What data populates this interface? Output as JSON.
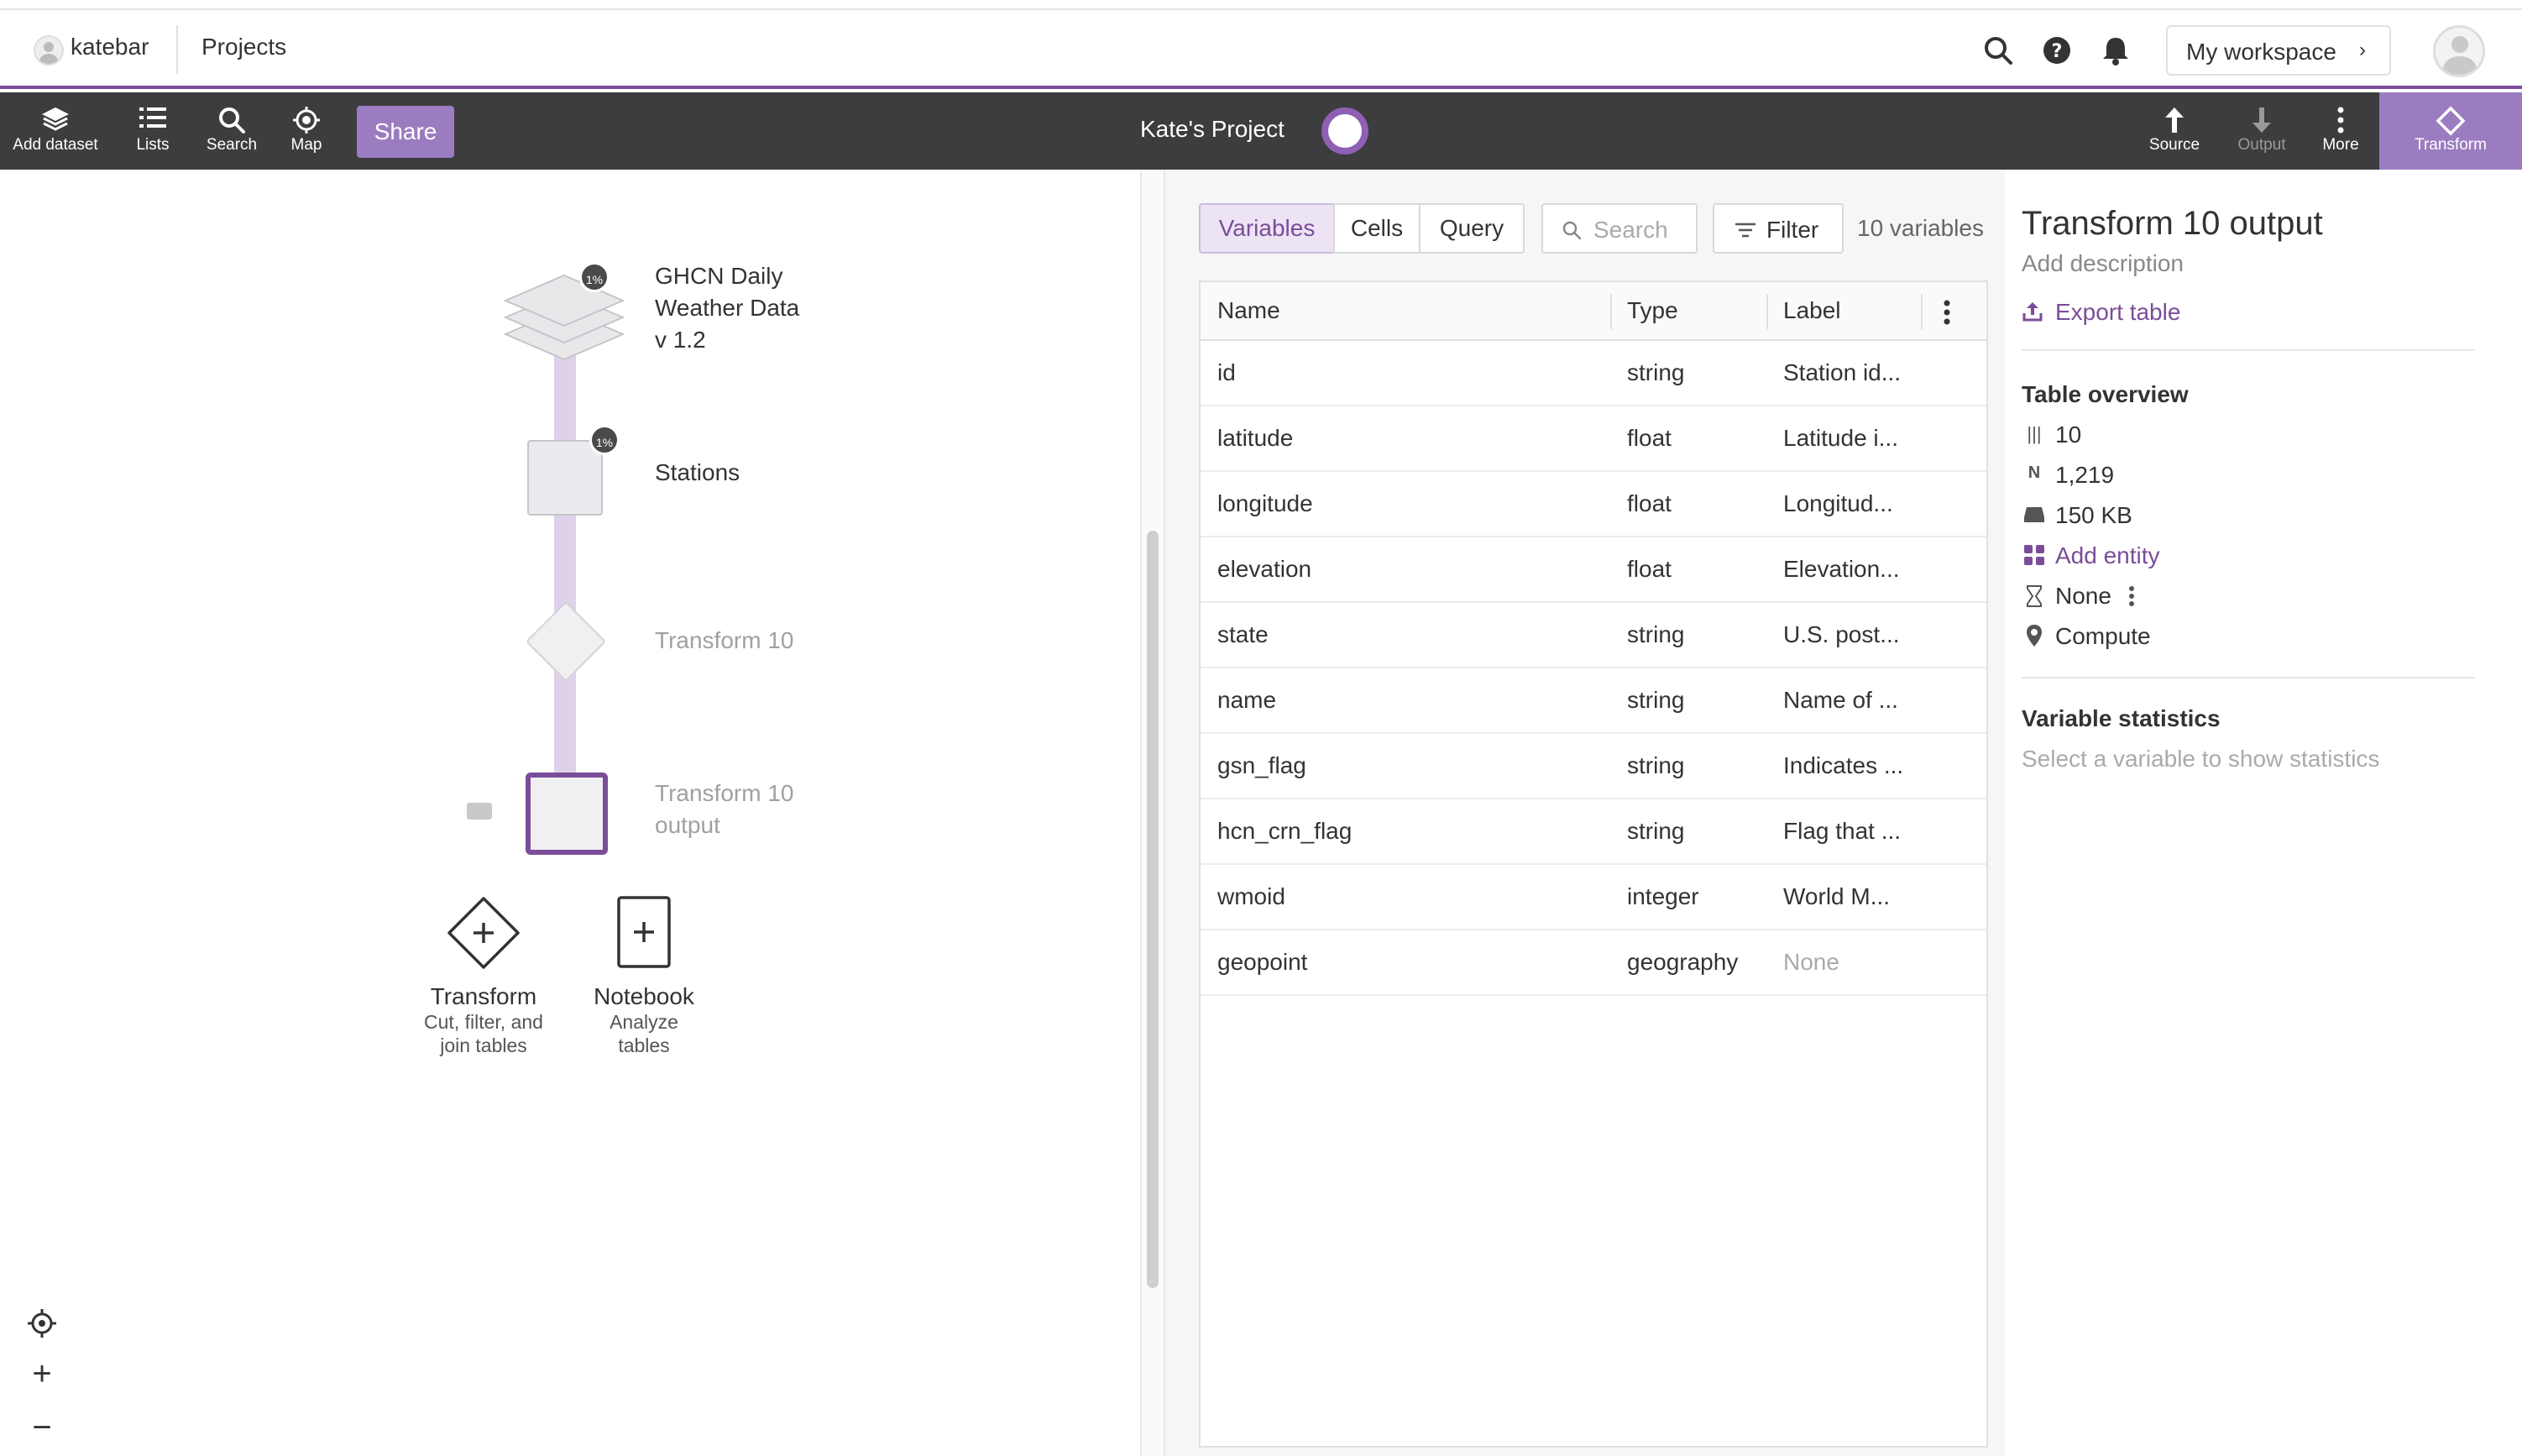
{
  "topbar": {
    "username": "katebar",
    "projects": "Projects",
    "workspace": "My workspace"
  },
  "toolbar": {
    "left_tools": [
      {
        "label": "Add dataset",
        "icon": "layers-icon"
      },
      {
        "label": "Lists",
        "icon": "list-icon"
      },
      {
        "label": "Search",
        "icon": "search-icon"
      },
      {
        "label": "Map",
        "icon": "map-target-icon"
      }
    ],
    "share": "Share",
    "project_title": "Kate's Project",
    "right_tools": [
      {
        "label": "Source",
        "icon": "arrow-up-icon"
      },
      {
        "label": "Output",
        "icon": "arrow-down-icon"
      },
      {
        "label": "More",
        "icon": "more-vertical-icon"
      },
      {
        "label": "Transform",
        "icon": "diamond-icon"
      }
    ]
  },
  "canvas": {
    "nodes": {
      "dataset": {
        "label_lines": [
          "GHCN Daily",
          "Weather Data",
          "v 1.2"
        ],
        "badge": "1%"
      },
      "stations": {
        "label": "Stations",
        "badge": "1%"
      },
      "transform": {
        "label": "Transform 10"
      },
      "output": {
        "label_lines": [
          "Transform 10",
          "output"
        ]
      }
    },
    "actions": [
      {
        "title": "Transform",
        "sub_lines": [
          "Cut, filter, and",
          "join tables"
        ]
      },
      {
        "title": "Notebook",
        "sub_lines": [
          "Analyze",
          "tables"
        ]
      }
    ],
    "zoom": {
      "plus": "+",
      "minus": "−"
    }
  },
  "panel": {
    "tabs": [
      "Variables",
      "Cells",
      "Query"
    ],
    "active_tab": "Variables",
    "search_placeholder": "Search",
    "filter": "Filter",
    "count": "10 variables",
    "columns": [
      "Name",
      "Type",
      "Label"
    ],
    "rows": [
      {
        "name": "id",
        "type": "string",
        "label": "Station id..."
      },
      {
        "name": "latitude",
        "type": "float",
        "label": "Latitude i..."
      },
      {
        "name": "longitude",
        "type": "float",
        "label": "Longitud..."
      },
      {
        "name": "elevation",
        "type": "float",
        "label": "Elevation..."
      },
      {
        "name": "state",
        "type": "string",
        "label": "U.S. post..."
      },
      {
        "name": "name",
        "type": "string",
        "label": "Name of ..."
      },
      {
        "name": "gsn_flag",
        "type": "string",
        "label": "Indicates ..."
      },
      {
        "name": "hcn_crn_flag",
        "type": "string",
        "label": "Flag that ..."
      },
      {
        "name": "wmoid",
        "type": "integer",
        "label": "World M..."
      },
      {
        "name": "geopoint",
        "type": "geography",
        "label": "None"
      }
    ]
  },
  "sidebar": {
    "title": "Transform 10 output",
    "description": "Add description",
    "export": "Export table",
    "overview_heading": "Table overview",
    "overview": {
      "variables": "10",
      "rows": "1,219",
      "size": "150 KB",
      "add_entity": "Add entity",
      "temporal": "None",
      "geo": "Compute"
    },
    "stats_heading": "Variable statistics",
    "stats_hint": "Select a variable to show statistics"
  },
  "colors": {
    "accent": "#7b4d99",
    "accent_light": "#9b7cc0",
    "toolbar_bg": "#3d3d3f"
  }
}
